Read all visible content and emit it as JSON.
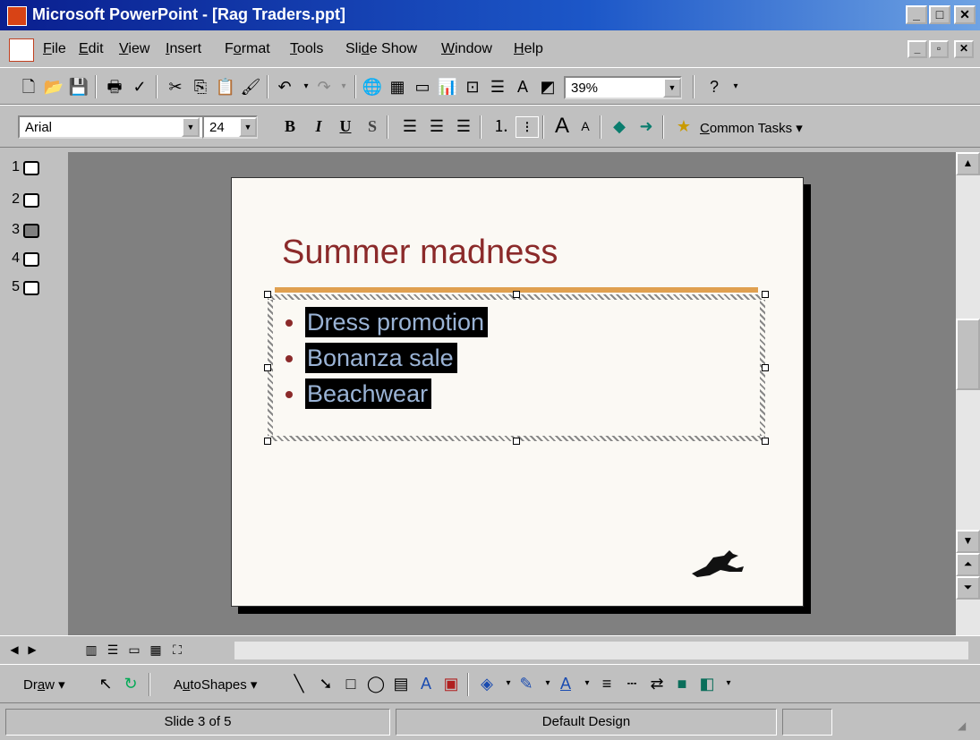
{
  "window": {
    "title": "Microsoft PowerPoint - [Rag Traders.ppt]",
    "minimize": "_",
    "maximize": "□",
    "close": "✕",
    "doc_minimize": "_",
    "doc_restore": "▫",
    "doc_close": "✕"
  },
  "menu": {
    "items": [
      {
        "pre": "",
        "key": "F",
        "post": "ile"
      },
      {
        "pre": "",
        "key": "E",
        "post": "dit"
      },
      {
        "pre": "",
        "key": "V",
        "post": "iew"
      },
      {
        "pre": "",
        "key": "I",
        "post": "nsert"
      },
      {
        "pre": "F",
        "key": "o",
        "post": "rmat"
      },
      {
        "pre": "",
        "key": "T",
        "post": "ools"
      },
      {
        "pre": "Sli",
        "key": "d",
        "post": "e Show"
      },
      {
        "pre": "",
        "key": "W",
        "post": "indow"
      },
      {
        "pre": "",
        "key": "H",
        "post": "elp"
      }
    ]
  },
  "standard_toolbar": {
    "zoom": "39%"
  },
  "format_toolbar": {
    "font": "Arial",
    "size": "24",
    "bold": "B",
    "italic": "I",
    "underline": "U",
    "shadow": "S",
    "common_tasks_pre": "",
    "common_tasks_key": "C",
    "common_tasks_post": "ommon Tasks"
  },
  "outline": {
    "slides": [
      "1",
      "2",
      "3",
      "4",
      "5"
    ],
    "selected": 3
  },
  "slide": {
    "title": "Summer madness",
    "bullets": [
      "Dress promotion",
      "Bonanza sale",
      "Beachwear"
    ],
    "title_color": "#8b2a2a",
    "bullet_color": "#8b2a2a",
    "highlight_text_color": "#9ab3d5"
  },
  "drawing_toolbar": {
    "draw_pre": "Dr",
    "draw_key": "a",
    "draw_post": "w",
    "autoshapes_pre": "A",
    "autoshapes_key": "u",
    "autoshapes_post": "toShapes"
  },
  "status": {
    "slide": "Slide 3 of 5",
    "design": "Default Design"
  }
}
